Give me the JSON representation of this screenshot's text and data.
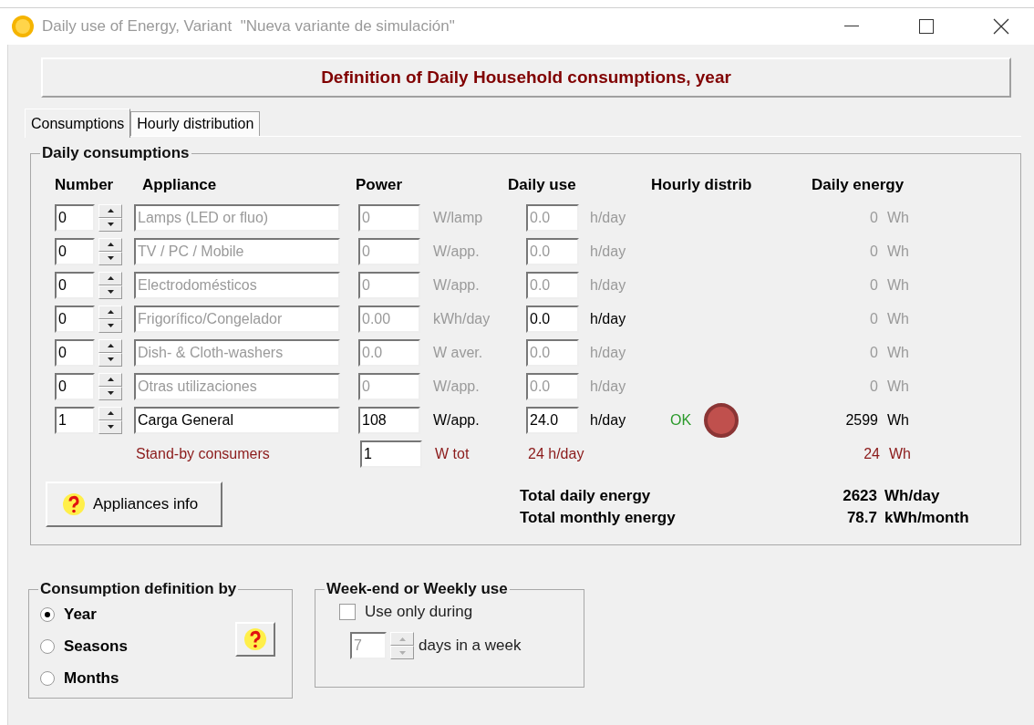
{
  "window": {
    "title": "Daily use of Energy, Variant  \"Nueva variante de simulación\""
  },
  "header": "Definition of Daily Household consumptions, year",
  "tabs": [
    {
      "label": "Consumptions",
      "selected": true
    },
    {
      "label": "Hourly distribution",
      "selected": false
    }
  ],
  "daily_consumptions": {
    "title": "Daily consumptions",
    "columns": [
      "Number",
      "Appliance",
      "Power",
      "Daily use",
      "Hourly distrib",
      "Daily energy"
    ],
    "rows": [
      {
        "number": "0",
        "name": "Lamps (LED or fluo)",
        "power": "0",
        "power_unit": "W/lamp",
        "use": "0.0",
        "use_unit": "h/day",
        "energy": "0",
        "energy_unit": "Wh",
        "enabled": false,
        "use_enabled": false
      },
      {
        "number": "0",
        "name": "TV / PC / Mobile",
        "power": "0",
        "power_unit": "W/app.",
        "use": "0.0",
        "use_unit": "h/day",
        "energy": "0",
        "energy_unit": "Wh",
        "enabled": false,
        "use_enabled": false
      },
      {
        "number": "0",
        "name": "Electrodomésticos",
        "power": "0",
        "power_unit": "W/app.",
        "use": "0.0",
        "use_unit": "h/day",
        "energy": "0",
        "energy_unit": "Wh",
        "enabled": false,
        "use_enabled": false
      },
      {
        "number": "0",
        "name": "Frigorífico/Congelador",
        "power": "0.00",
        "power_unit": "kWh/day",
        "use": "0.0",
        "use_unit": "h/day",
        "energy": "0",
        "energy_unit": "Wh",
        "enabled": false,
        "use_enabled": true
      },
      {
        "number": "0",
        "name": "Dish- & Cloth-washers",
        "power": "0.0",
        "power_unit": "W aver.",
        "use": "0.0",
        "use_unit": "h/day",
        "energy": "0",
        "energy_unit": "Wh",
        "enabled": false,
        "use_enabled": false
      },
      {
        "number": "0",
        "name": "Otras utilizaciones",
        "power": "0",
        "power_unit": "W/app.",
        "use": "0.0",
        "use_unit": "h/day",
        "energy": "0",
        "energy_unit": "Wh",
        "enabled": false,
        "use_enabled": false
      },
      {
        "number": "1",
        "name": "Carga General",
        "power": "108",
        "power_unit": "W/app.",
        "use": "24.0",
        "use_unit": "h/day",
        "energy": "2599",
        "energy_unit": "Wh",
        "enabled": true,
        "use_enabled": true,
        "distrib": {
          "status": "OK",
          "color": "#c0504d"
        }
      }
    ],
    "standby": {
      "label": "Stand-by consumers",
      "power": "1",
      "power_unit": "W tot",
      "use": "24 h/day",
      "energy": "24",
      "energy_unit": "Wh"
    },
    "info_button": "Appliances info",
    "totals": [
      {
        "label": "Total daily energy",
        "value": "2623",
        "unit": "Wh/day"
      },
      {
        "label": "Total monthly energy",
        "value": "78.7",
        "unit": "kWh/month"
      }
    ]
  },
  "definition_by": {
    "title": "Consumption definition by",
    "options": [
      {
        "label": "Year",
        "selected": true
      },
      {
        "label": "Seasons",
        "selected": false
      },
      {
        "label": "Months",
        "selected": false
      }
    ]
  },
  "weekly": {
    "title": "Week-end or Weekly use",
    "checkbox": {
      "label": "Use only during",
      "checked": false
    },
    "days": {
      "value": "7",
      "disabled": true
    },
    "days_label": "days in a week"
  }
}
